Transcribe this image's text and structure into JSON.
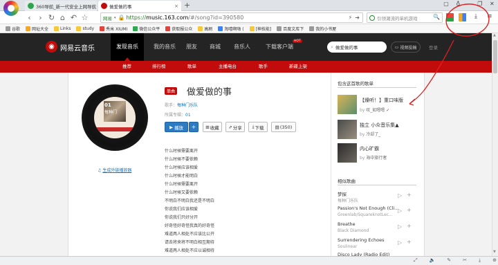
{
  "browser": {
    "tabs": [
      {
        "label": "360导航_新一代安全上网导航",
        "active": false
      },
      {
        "label": "做爱做的事",
        "active": true
      }
    ],
    "address_prefix": "网易",
    "url_scheme": "https://",
    "url_host": "music.163.com",
    "url_path": "/#/song?id=390580",
    "search_placeholder": "引领潮流的单机游戏",
    "bookmarks": [
      "谷歌",
      "网址大全",
      "Links",
      "study",
      "秀米 XIUMI",
      "微信公众平",
      "获取报公众",
      "高刷",
      "淘嘻啊嗨 (",
      "[神技能]",
      "百度文库下",
      "我的小书屋"
    ]
  },
  "site": {
    "logo_text": "网易云音乐",
    "nav": [
      "发现音乐",
      "我的音乐",
      "朋友",
      "商城",
      "音乐人",
      "下载客户端"
    ],
    "hot_badge": "HOT",
    "search_placeholder": "做爱做的事",
    "creator_center": "视频投稿",
    "login": "登录",
    "subnav": [
      "推荐",
      "排行榜",
      "歌单",
      "主播电台",
      "歌手",
      "新碟上架"
    ]
  },
  "song": {
    "tag": "单曲",
    "title": "做爱做的事",
    "artist_label": "歌手：",
    "artist": "每种门乐队",
    "album_label": "所属专辑：",
    "album": "01",
    "album_cover_text_top": "01",
    "album_cover_text_bottom": "每种门",
    "outchain_label": "生成外链播放器",
    "buttons": {
      "play": "播放",
      "add": "+",
      "collect": "收藏",
      "share": "分享",
      "download": "下载",
      "comment": "(350)"
    },
    "lyrics": [
      "什么时候需要离开",
      "什么时候不要依赖",
      "什么时候应该相爱",
      "什么时候才能明白",
      "什么时候需要离开",
      "什么时候又要依赖",
      "不明白不明白我还是不明白",
      "你说我们应该相爱",
      "你说我们只好分开",
      "好奇怪好奇怪我真的好奇怪",
      "难道两人相处不应该比公开",
      "请去将来将不明白相互期待",
      "难道两人相处不应以诚相待"
    ]
  },
  "sidebar": {
    "playlists_title": "包含这首歌的歌单",
    "playlists": [
      {
        "name": "【燥听！】重口味版",
        "creator_prefix": "by",
        "creator": "叹_如嗯嗯"
      },
      {
        "name": "独立 小众音乐集▲",
        "creator_prefix": "by",
        "creator": "冷却了_"
      },
      {
        "name": "内心旷霸",
        "creator_prefix": "by",
        "creator": "海中旅行者"
      }
    ],
    "similar_title": "相似歌曲",
    "similar": [
      {
        "name": "梦探",
        "artist": "每种门乐队"
      },
      {
        "name": "Passion's Not Enough (Cli...",
        "artist": "Greenlab/SquareknotLec..."
      },
      {
        "name": "Breathe",
        "artist": "Black Diamond"
      },
      {
        "name": "Surrendering Echoes",
        "artist": "Soulinear"
      },
      {
        "name": "Disco Lady (Radio Edit)",
        "artist": ""
      }
    ]
  },
  "annotation_color": "#e02020"
}
